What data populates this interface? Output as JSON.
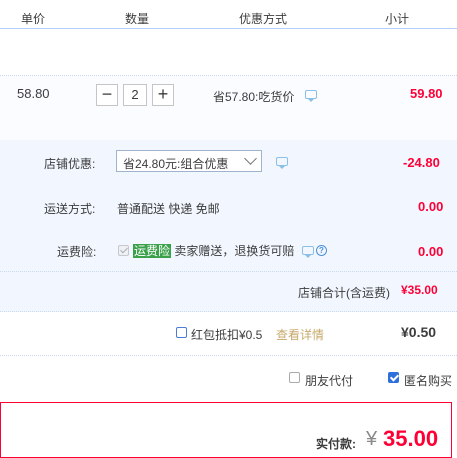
{
  "header": {
    "col_price": "单价",
    "col_qty": "数量",
    "col_discount": "优惠方式",
    "col_subtotal": "小计"
  },
  "item": {
    "price": "58.80",
    "quantity": "2",
    "minus": "−",
    "plus": "+",
    "discount": "省57.80:吃货价",
    "subtotal": "59.80"
  },
  "shop": {
    "discount_label": "店铺优惠:",
    "discount_select": "省24.80元:组合优惠",
    "discount_amount": "-24.80",
    "shipping_label": "运送方式:",
    "shipping_value": "普通配送 快递 免邮",
    "shipping_amount": "0.00",
    "insurance_label": "运费险:",
    "insurance_tag": "运费险",
    "insurance_desc": "卖家赠送，退换货可赔",
    "insurance_amount": "0.00",
    "total_label": "店铺合计(含运费)",
    "total_amount": "¥35.00"
  },
  "redpacket": {
    "label": "红包抵扣¥0.5",
    "link": "查看详情",
    "amount": "¥0.50"
  },
  "options": {
    "friend_pay": "朋友代付",
    "anonymous": "匿名购买"
  },
  "payment": {
    "label": "实付款:",
    "currency": "¥",
    "amount": "35.00"
  },
  "colors": {
    "accent_red": "#ff0036",
    "light_blue_bg": "#f2f7ff",
    "header_line": "#b2d1ff"
  }
}
